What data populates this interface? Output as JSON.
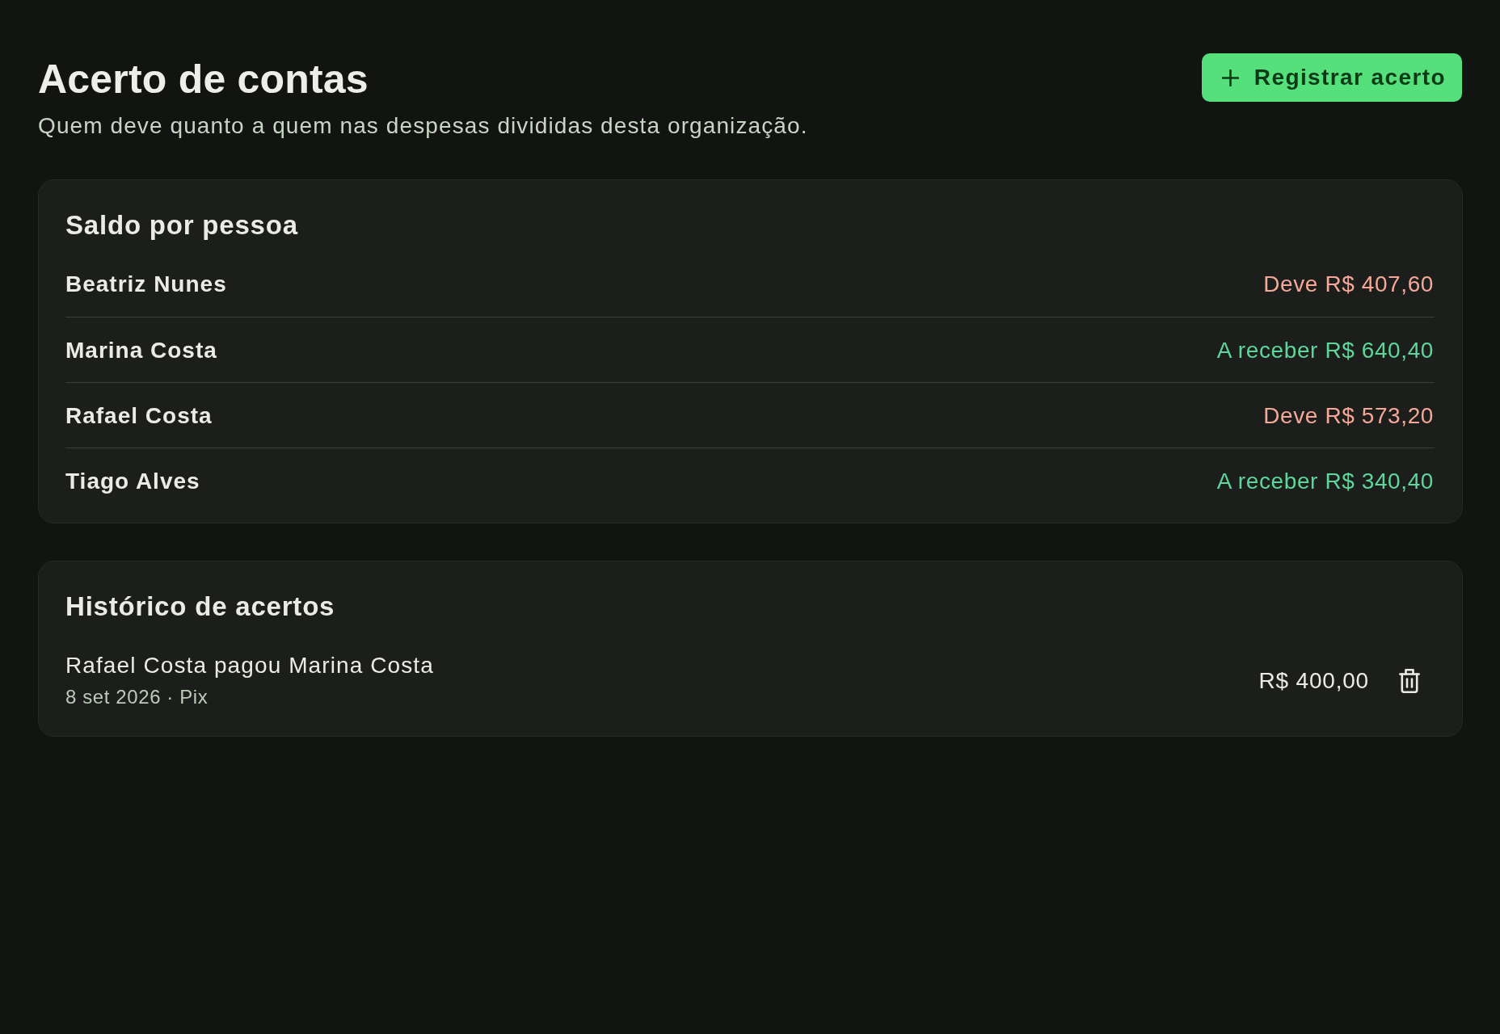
{
  "header": {
    "title": "Acerto de contas",
    "subtitle": "Quem deve quanto a quem nas despesas divididas desta organização.",
    "action": {
      "label": "Registrar acerto"
    }
  },
  "balances": {
    "title": "Saldo por pessoa",
    "people": [
      {
        "name": "Beatriz Nunes",
        "balance": "Deve R$ 407,60",
        "color": "#f5a898"
      },
      {
        "name": "Marina Costa",
        "balance": "A receber R$ 640,40",
        "color": "#5ed59b"
      },
      {
        "name": "Rafael Costa",
        "balance": "Deve R$ 573,20",
        "color": "#f5a898"
      },
      {
        "name": "Tiago Alves",
        "balance": "A receber R$ 340,40",
        "color": "#5ed59b"
      }
    ]
  },
  "history": {
    "title": "Histórico de acertos",
    "entries": [
      {
        "description": "Rafael Costa pagou Marina Costa",
        "details": "8 set 2026 · Pix",
        "amount": "R$ 400,00"
      }
    ]
  }
}
